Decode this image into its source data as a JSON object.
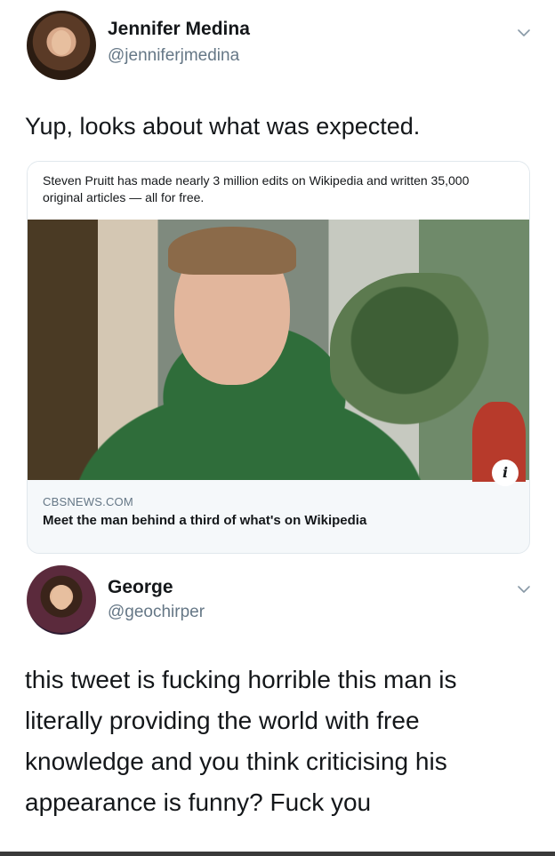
{
  "tweets": [
    {
      "display_name": "Jennifer Medina",
      "handle": "@jenniferjmedina",
      "text": "Yup, looks about what was expected.",
      "card": {
        "description": "Steven Pruitt has made nearly 3 million edits on Wikipedia and written 35,000 original articles — all for free.",
        "domain": "CBSNEWS.COM",
        "title": "Meet the man behind a third of what's on Wikipedia",
        "info_icon": "i"
      }
    },
    {
      "display_name": "George",
      "handle": "@geochirper",
      "text_lines": [
        "this tweet is fucking horrible this man is",
        "literally providing the world with free",
        "knowledge and you think criticising his",
        "appearance is funny? Fuck you"
      ]
    }
  ],
  "icons": {
    "menu": "chevron-down-icon",
    "info": "info-icon"
  },
  "colors": {
    "text": "#14171a",
    "secondary": "#657786",
    "card_border": "#e1e8ed",
    "card_bg": "#f5f8fa"
  }
}
